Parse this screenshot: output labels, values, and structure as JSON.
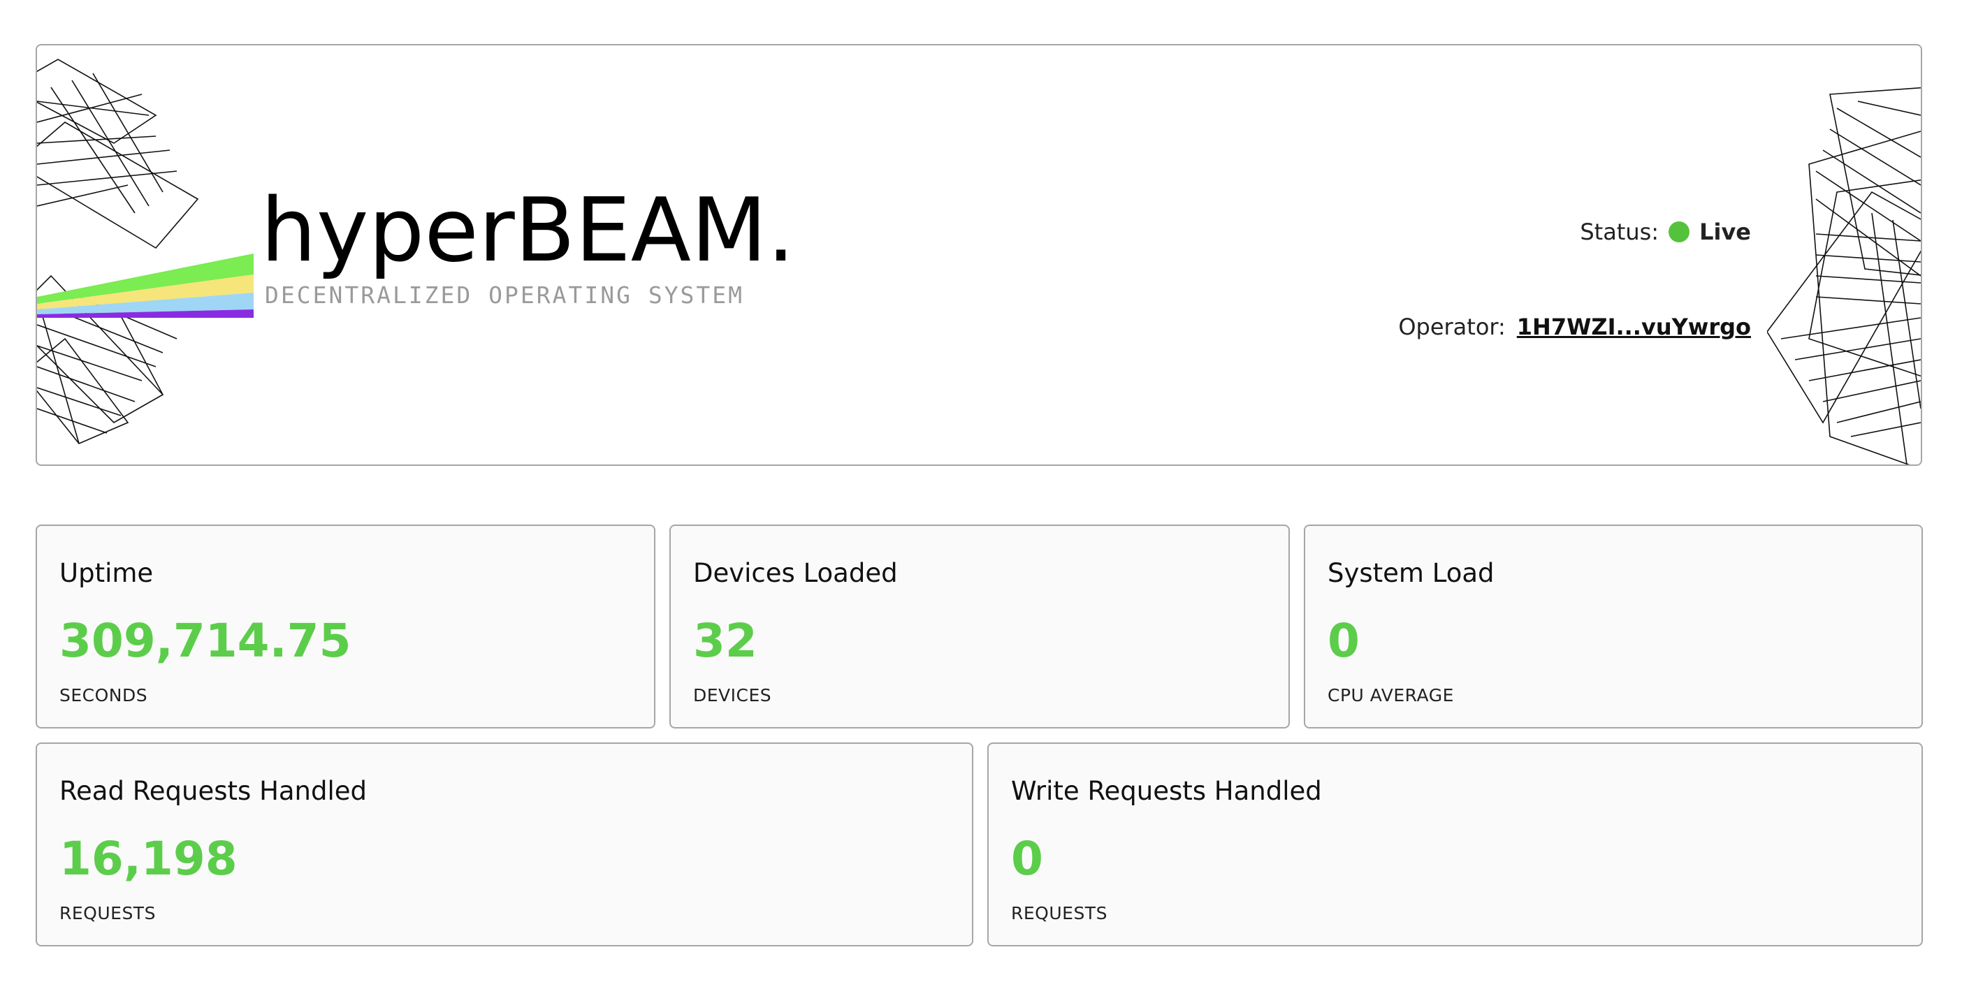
{
  "header": {
    "logo_title": "hyperBEAM.",
    "logo_subtitle": "DECENTRALIZED OPERATING SYSTEM",
    "status_label": "Status:",
    "status_value": "Live",
    "status_color": "#55c23d",
    "operator_label": "Operator:",
    "operator_value": "1H7WZI...vuYwrgo"
  },
  "beam_colors": [
    "#7bec52",
    "#f5e57a",
    "#9fd6f5",
    "#8a2be2",
    "#e8302b"
  ],
  "metrics": [
    {
      "title": "Uptime",
      "value": "309,714.75",
      "unit": "SECONDS"
    },
    {
      "title": "Devices Loaded",
      "value": "32",
      "unit": "DEVICES"
    },
    {
      "title": "System Load",
      "value": "0",
      "unit": "CPU AVERAGE"
    },
    {
      "title": "Read Requests Handled",
      "value": "16,198",
      "unit": "REQUESTS"
    },
    {
      "title": "Write Requests Handled",
      "value": "0",
      "unit": "REQUESTS"
    }
  ],
  "accent_color": "#5ccd4a"
}
